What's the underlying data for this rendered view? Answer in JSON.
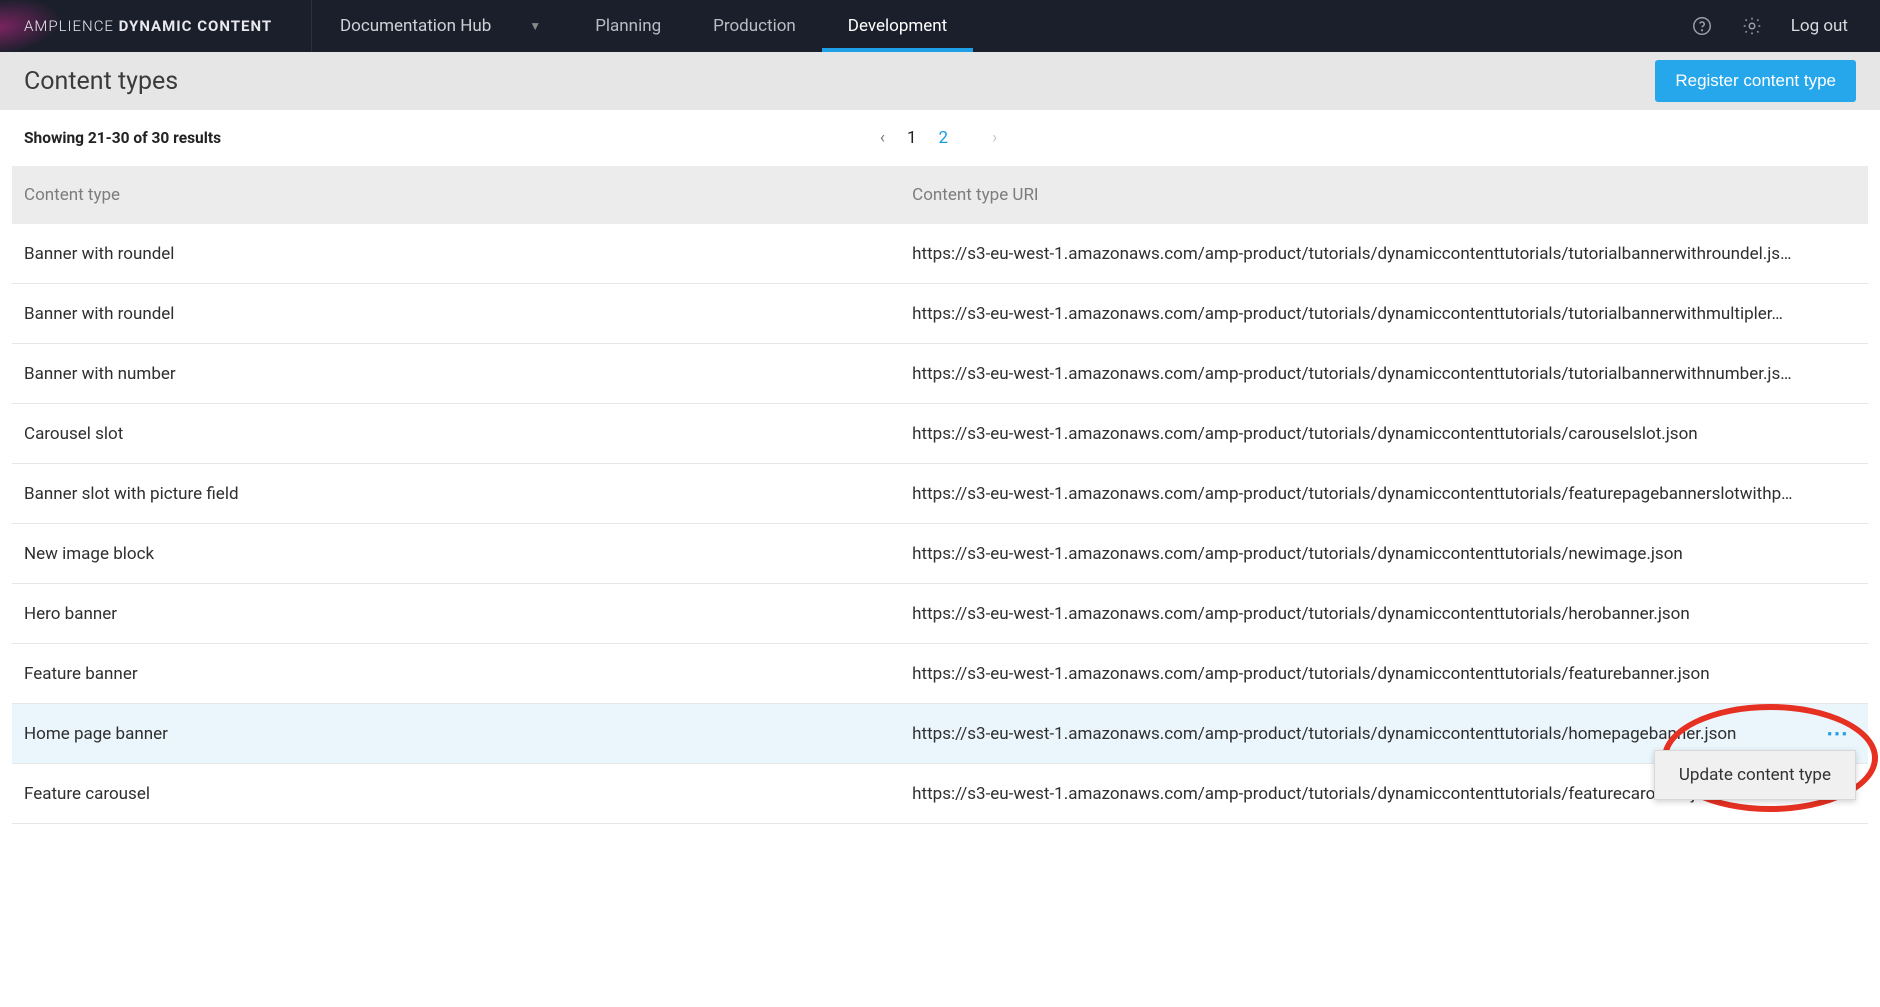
{
  "brand": {
    "part1": "AMPLIENCE ",
    "part2": "DYNAMIC CONTENT"
  },
  "hub_selector": "Documentation Hub",
  "nav": {
    "planning": "Planning",
    "production": "Production",
    "development": "Development",
    "active": "development"
  },
  "logout": "Log out",
  "page_title": "Content types",
  "register_button": "Register content type",
  "showing": "Showing 21-30 of 30 results",
  "pagination": {
    "pages": [
      "1",
      "2"
    ],
    "current": "2",
    "prev_enabled": true,
    "next_enabled": false
  },
  "columns": {
    "name": "Content type",
    "uri": "Content type URI"
  },
  "rows": [
    {
      "name": "Banner with roundel",
      "uri": "https://s3-eu-west-1.amazonaws.com/amp-product/tutorials/dynamiccontenttutorials/tutorialbannerwithroundel.js…"
    },
    {
      "name": "Banner with roundel",
      "uri": "https://s3-eu-west-1.amazonaws.com/amp-product/tutorials/dynamiccontenttutorials/tutorialbannerwithmultipler…"
    },
    {
      "name": "Banner with number",
      "uri": "https://s3-eu-west-1.amazonaws.com/amp-product/tutorials/dynamiccontenttutorials/tutorialbannerwithnumber.js…"
    },
    {
      "name": "Carousel slot",
      "uri": "https://s3-eu-west-1.amazonaws.com/amp-product/tutorials/dynamiccontenttutorials/carouselslot.json"
    },
    {
      "name": "Banner slot with picture field",
      "uri": "https://s3-eu-west-1.amazonaws.com/amp-product/tutorials/dynamiccontenttutorials/featurepagebannerslotwithp…"
    },
    {
      "name": "New image block",
      "uri": "https://s3-eu-west-1.amazonaws.com/amp-product/tutorials/dynamiccontenttutorials/newimage.json"
    },
    {
      "name": "Hero banner",
      "uri": "https://s3-eu-west-1.amazonaws.com/amp-product/tutorials/dynamiccontenttutorials/herobanner.json"
    },
    {
      "name": "Feature banner",
      "uri": "https://s3-eu-west-1.amazonaws.com/amp-product/tutorials/dynamiccontenttutorials/featurebanner.json"
    },
    {
      "name": "Home page banner",
      "uri": "https://s3-eu-west-1.amazonaws.com/amp-product/tutorials/dynamiccontenttutorials/homepagebanner.json",
      "selected": true,
      "menu_open": true
    },
    {
      "name": "Feature carousel",
      "uri": "https://s3-eu-west-1.amazonaws.com/amp-product/tutorials/dynamiccontenttutorials/featurecarousel.json"
    }
  ],
  "row_menu": {
    "update": "Update content type"
  }
}
